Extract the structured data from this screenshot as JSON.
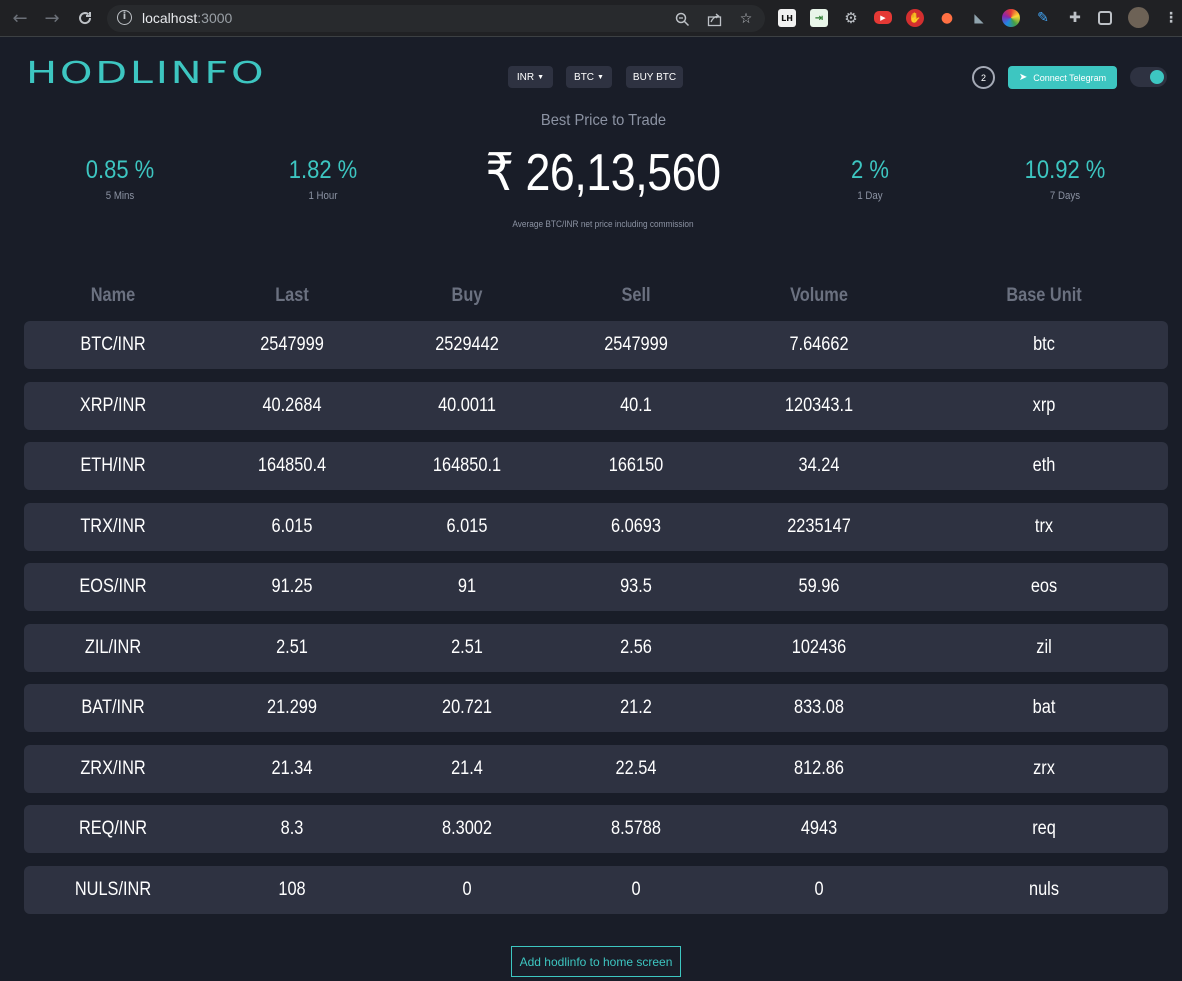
{
  "browser": {
    "url_host": "localhost",
    "url_port": ":3000",
    "extensions": [
      "LH",
      "tab-icon",
      "gear",
      "yt-icon",
      "hand-icon",
      "dot-icon",
      "hat-icon",
      "color-icon",
      "pen-icon"
    ]
  },
  "header": {
    "logo": "HODLINFO",
    "currency_dropdown": "INR",
    "coin_dropdown": "BTC",
    "buy_button": "BUY BTC",
    "timer": "2",
    "telegram_button": "Connect Telegram"
  },
  "banner": {
    "title": "Best Price to Trade",
    "price": "₹ 26,13,560",
    "note": "Average BTC/INR net price including commission",
    "stats": [
      {
        "value": "0.85 %",
        "label": "5 Mins"
      },
      {
        "value": "1.82 %",
        "label": "1 Hour"
      },
      {
        "value": "2 %",
        "label": "1 Day"
      },
      {
        "value": "10.92 %",
        "label": "7 Days"
      }
    ]
  },
  "table": {
    "headers": [
      "Name",
      "Last",
      "Buy",
      "Sell",
      "Volume",
      "Base Unit"
    ],
    "rows": [
      [
        "BTC/INR",
        "2547999",
        "2529442",
        "2547999",
        "7.64662",
        "btc"
      ],
      [
        "XRP/INR",
        "40.2684",
        "40.0011",
        "40.1",
        "120343.1",
        "xrp"
      ],
      [
        "ETH/INR",
        "164850.4",
        "164850.1",
        "166150",
        "34.24",
        "eth"
      ],
      [
        "TRX/INR",
        "6.015",
        "6.015",
        "6.0693",
        "2235147",
        "trx"
      ],
      [
        "EOS/INR",
        "91.25",
        "91",
        "93.5",
        "59.96",
        "eos"
      ],
      [
        "ZIL/INR",
        "2.51",
        "2.51",
        "2.56",
        "102436",
        "zil"
      ],
      [
        "BAT/INR",
        "21.299",
        "20.721",
        "21.2",
        "833.08",
        "bat"
      ],
      [
        "ZRX/INR",
        "21.34",
        "21.4",
        "22.54",
        "812.86",
        "zrx"
      ],
      [
        "REQ/INR",
        "8.3",
        "8.3002",
        "8.5788",
        "4943",
        "req"
      ],
      [
        "NULS/INR",
        "108",
        "0",
        "0",
        "0",
        "nuls"
      ]
    ]
  },
  "footer": {
    "add_home": "Add hodlinfo to home screen"
  },
  "colors": {
    "accent": "#3dc6c1",
    "background": "#191d28",
    "row_bg": "#2e3241"
  }
}
